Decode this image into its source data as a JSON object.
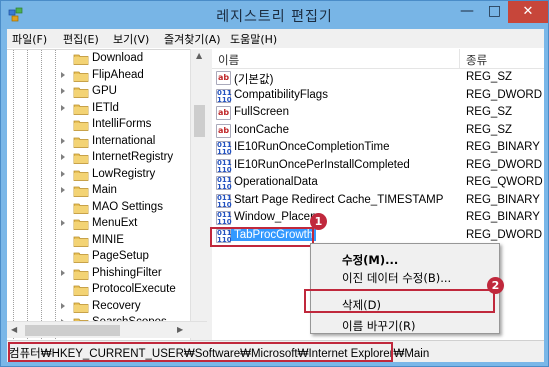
{
  "window": {
    "title": "레지스트리 편집기",
    "minimize": "—",
    "maximize": "□",
    "close": "✕"
  },
  "menubar": [
    {
      "label": "파일(F)"
    },
    {
      "label": "편집(E)"
    },
    {
      "label": "보기(V)"
    },
    {
      "label": "즐겨찾기(A)"
    },
    {
      "label": "도움말(H)"
    }
  ],
  "tree": {
    "items": [
      {
        "label": "Download",
        "expandable": false
      },
      {
        "label": "FlipAhead",
        "expandable": true
      },
      {
        "label": "GPU",
        "expandable": true
      },
      {
        "label": "IETld",
        "expandable": true
      },
      {
        "label": "IntelliForms",
        "expandable": false
      },
      {
        "label": "International",
        "expandable": true
      },
      {
        "label": "InternetRegistry",
        "expandable": true
      },
      {
        "label": "LowRegistry",
        "expandable": true
      },
      {
        "label": "Main",
        "expandable": true
      },
      {
        "label": "MAO Settings",
        "expandable": false
      },
      {
        "label": "MenuExt",
        "expandable": true
      },
      {
        "label": "MINIE",
        "expandable": false
      },
      {
        "label": "PageSetup",
        "expandable": false
      },
      {
        "label": "PhishingFilter",
        "expandable": true
      },
      {
        "label": "ProtocolExecute",
        "expandable": false
      },
      {
        "label": "Recovery",
        "expandable": true
      },
      {
        "label": "SearchScopes",
        "expandable": true
      }
    ]
  },
  "list": {
    "columns": {
      "name": "이름",
      "type": "종류"
    },
    "rows": [
      {
        "name": "(기본값)",
        "type": "REG_SZ",
        "icon": "string-value-icon"
      },
      {
        "name": "CompatibilityFlags",
        "type": "REG_DWORD",
        "icon": "binary-value-icon"
      },
      {
        "name": "FullScreen",
        "type": "REG_SZ",
        "icon": "string-value-icon"
      },
      {
        "name": "IconCache",
        "type": "REG_SZ",
        "icon": "string-value-icon"
      },
      {
        "name": "IE10RunOnceCompletionTime",
        "type": "REG_BINARY",
        "icon": "binary-value-icon"
      },
      {
        "name": "IE10RunOncePerInstallCompleted",
        "type": "REG_DWORD",
        "icon": "binary-value-icon"
      },
      {
        "name": "OperationalData",
        "type": "REG_QWORD",
        "icon": "binary-value-icon"
      },
      {
        "name": "Start Page Redirect Cache_TIMESTAMP",
        "type": "REG_BINARY",
        "icon": "binary-value-icon"
      },
      {
        "name": "Window_Placen",
        "type": "REG_BINARY",
        "icon": "binary-value-icon"
      },
      {
        "name": "TabProcGrowth",
        "type": "REG_DWORD",
        "icon": "binary-value-icon"
      }
    ],
    "selected_index": 9
  },
  "context_menu": {
    "items": [
      {
        "label": "수정(M)...",
        "bold": true
      },
      {
        "label": "이진 데이터 수정(B)..."
      },
      {
        "label": "삭제(D)"
      },
      {
        "label": "이름 바꾸기(R)"
      }
    ]
  },
  "statusbar": {
    "path": "컴퓨터₩HKEY_CURRENT_USER₩Software₩Microsoft₩Internet Explorer₩Main"
  },
  "markers": {
    "one": "1",
    "two": "2"
  },
  "icon_text": {
    "string_value": "ab",
    "binary_value": "011\n110"
  },
  "colors": {
    "highlight": "#c0283c",
    "selection": "#3399ff",
    "titlebar": "#78b5e6",
    "close_button": "#c7463a"
  }
}
